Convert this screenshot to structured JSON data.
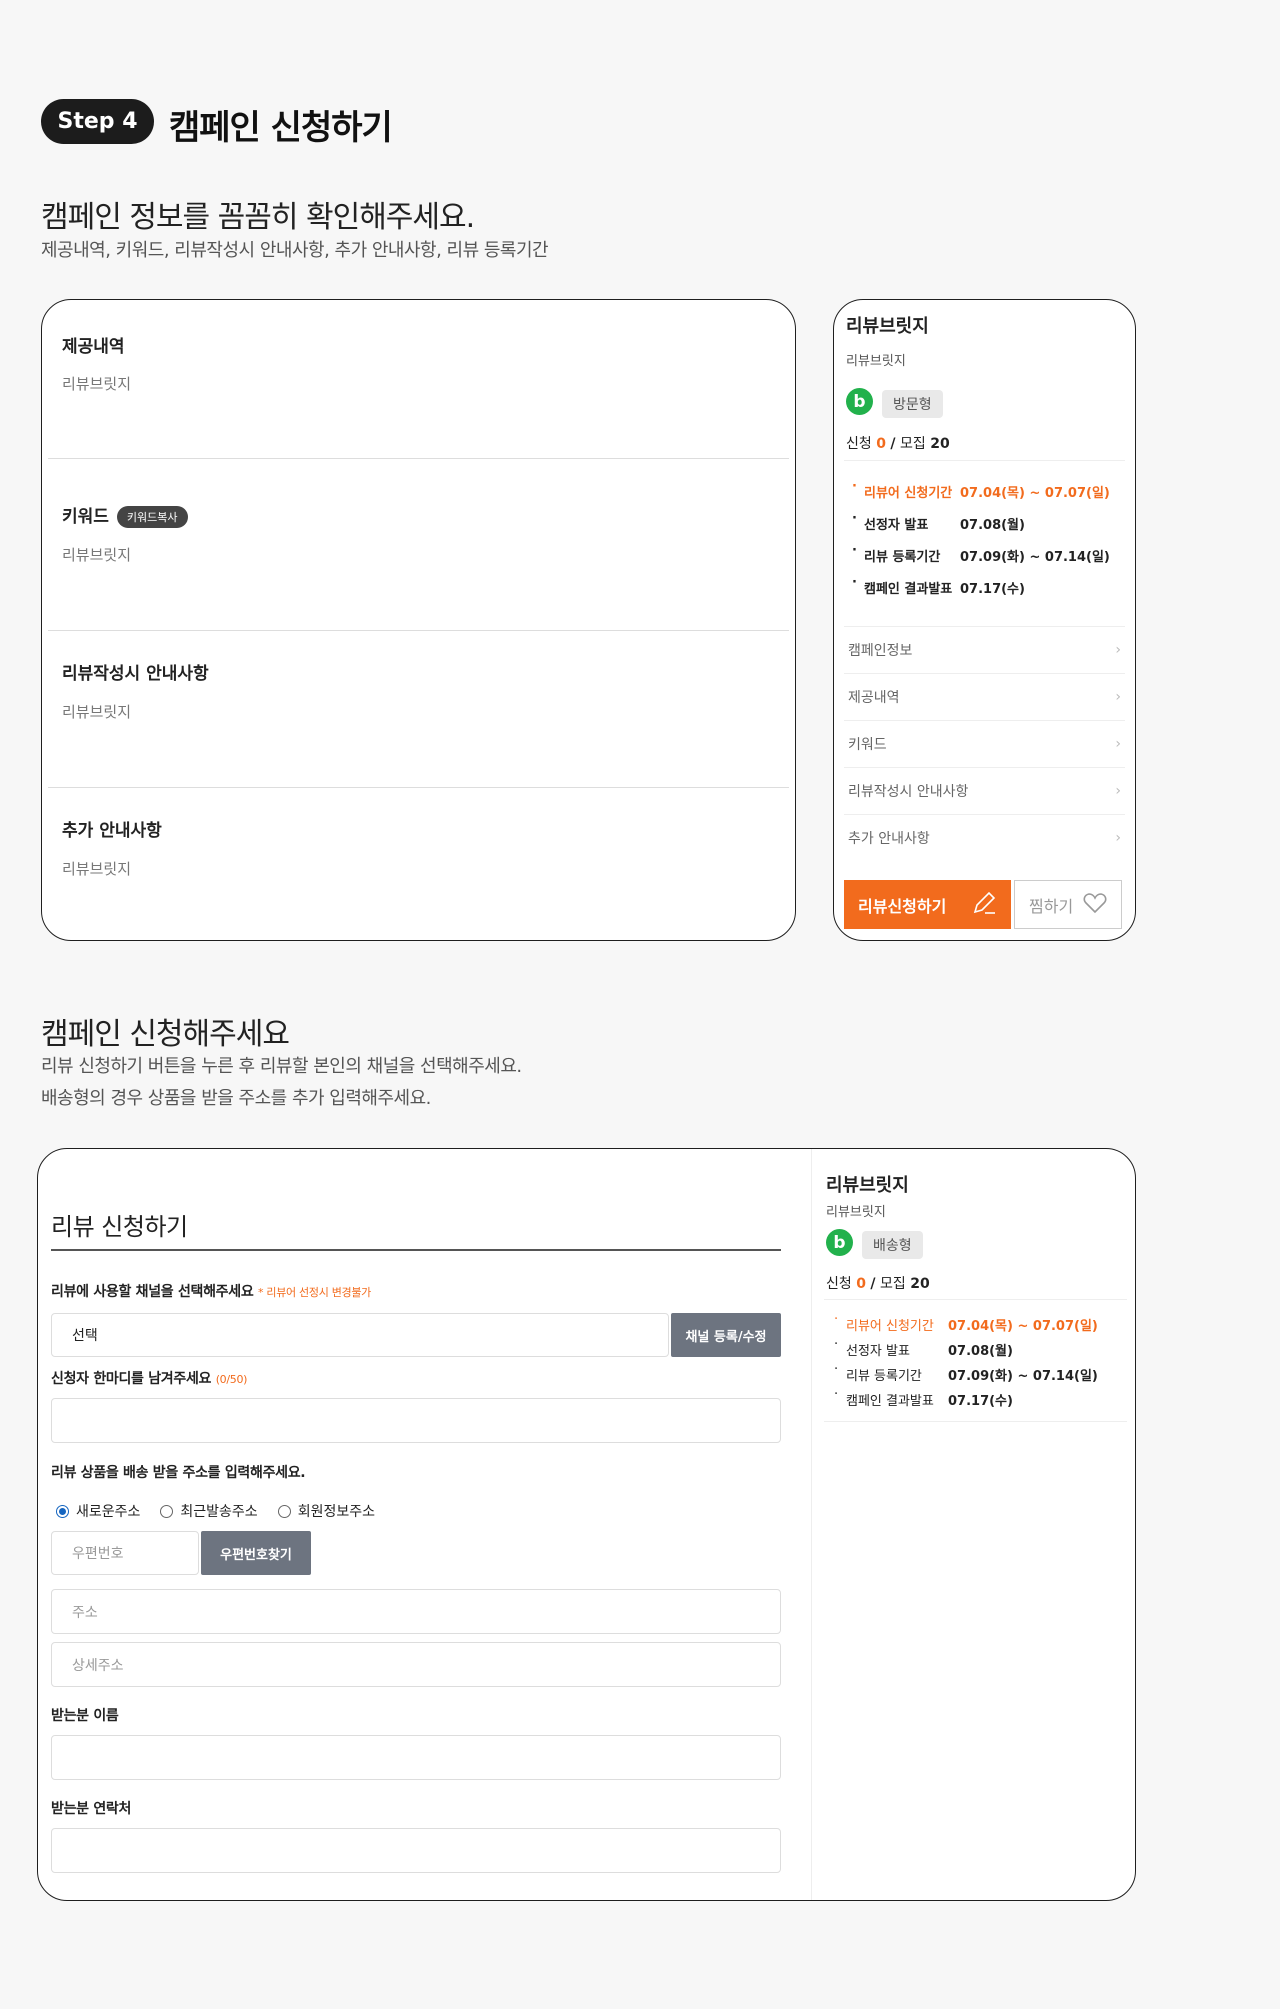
{
  "step": {
    "badge": "Step 4",
    "title": "캠페인 신청하기"
  },
  "section1": {
    "heading": "캠페인 정보를 꼼꼼히 확인해주세요.",
    "desc": "제공내역, 키워드, 리뷰작성시 안내사항, 추가 안내사항, 리뷰 등록기간",
    "blocks": [
      {
        "title": "제공내역",
        "body": "리뷰브릿지"
      },
      {
        "title": "키워드",
        "badge": "키워드복사",
        "body": "리뷰브릿지"
      },
      {
        "title": "리뷰작성시 안내사항",
        "body": "리뷰브릿지"
      },
      {
        "title": "추가 안내사항",
        "body": "리뷰브릿지"
      }
    ]
  },
  "side1": {
    "title": "리뷰브릿지",
    "subtitle": "리뷰브릿지",
    "b_icon": "b",
    "type": "방문형",
    "counts": {
      "apply_label": "신청",
      "apply": "0",
      "sep": "/",
      "recruit_label": "모집",
      "recruit": "20"
    },
    "schedule": [
      {
        "label": "리뷰어 신청기간",
        "value": "07.04(목) ~ 07.07(일)",
        "highlight": true
      },
      {
        "label": "선정자 발표",
        "value": "07.08(월)",
        "highlight": false
      },
      {
        "label": "리뷰 등록기간",
        "value": "07.09(화) ~ 07.14(일)",
        "highlight": false
      },
      {
        "label": "캠페인 결과발표",
        "value": "07.17(수)",
        "highlight": false
      }
    ],
    "menu": [
      "캠페인정보",
      "제공내역",
      "키워드",
      "리뷰작성시 안내사항",
      "추가 안내사항"
    ],
    "apply_btn": "리뷰신청하기",
    "like_btn": "찜하기",
    "colors": {
      "accent": "#f26b1d",
      "green": "#22b14c"
    }
  },
  "section2": {
    "heading": "캠페인 신청해주세요",
    "desc1": "리뷰 신청하기 버튼을 누른 후 리뷰할 본인의 채널을 선택해주세요.",
    "desc2": "배송형의 경우 상품을 받을 주소를 추가 입력해주세요."
  },
  "form": {
    "title": "리뷰 신청하기",
    "channel_label": "리뷰에 사용할 채널을 선택해주세요",
    "channel_note": "* 리뷰어 선정시 변경불가",
    "channel_select": "선택",
    "channel_btn": "채널 등록/수정",
    "comment_label": "신청자 한마디를 남겨주세요",
    "comment_count": "(0/50)",
    "address_label": "리뷰 상품을 배송 받을 주소를 입력해주세요.",
    "radios": [
      {
        "label": "새로운주소",
        "checked": true
      },
      {
        "label": "최근발송주소",
        "checked": false
      },
      {
        "label": "회원정보주소",
        "checked": false
      }
    ],
    "zip_placeholder": "우편번호",
    "zip_btn": "우편번호찾기",
    "addr_placeholder": "주소",
    "addr_detail_placeholder": "상세주소",
    "name_label": "받는분 이름",
    "phone_label": "받는분 연락처"
  },
  "side2": {
    "title": "리뷰브릿지",
    "subtitle": "리뷰브릿지",
    "b_icon": "b",
    "type": "배송형",
    "counts": {
      "apply_label": "신청",
      "apply": "0",
      "sep": "/",
      "recruit_label": "모집",
      "recruit": "20"
    },
    "schedule": [
      {
        "label": "리뷰어 신청기간",
        "value": "07.04(목) ~ 07.07(일)",
        "highlight": true
      },
      {
        "label": "선정자 발표",
        "value": "07.08(월)",
        "highlight": false
      },
      {
        "label": "리뷰 등록기간",
        "value": "07.09(화) ~ 07.14(일)",
        "highlight": false
      },
      {
        "label": "캠페인 결과발표",
        "value": "07.17(수)",
        "highlight": false
      }
    ]
  }
}
